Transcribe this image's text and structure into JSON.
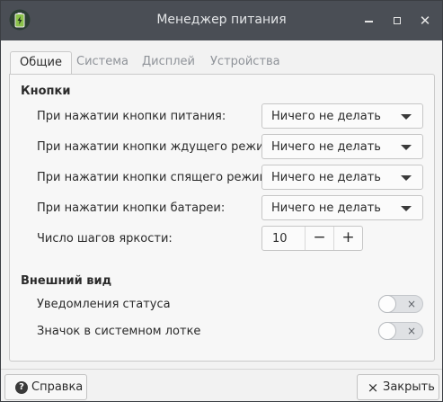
{
  "window": {
    "title": "Менеджер питания",
    "icon": "battery-icon"
  },
  "tabs": [
    {
      "label": "Общие",
      "active": true
    },
    {
      "label": "Система",
      "active": false
    },
    {
      "label": "Дисплей",
      "active": false
    },
    {
      "label": "Устройства",
      "active": false
    }
  ],
  "buttons_section": {
    "title": "Кнопки",
    "rows": [
      {
        "label": "При нажатии кнопки питания:",
        "value": "Ничего не делать"
      },
      {
        "label": "При нажатии кнопки ждущего режима:",
        "value": "Ничего не делать"
      },
      {
        "label": "При нажатии кнопки спящего режима:",
        "value": "Ничего не делать"
      },
      {
        "label": "При нажатии кнопки батареи:",
        "value": "Ничего не делать"
      }
    ],
    "brightness": {
      "label": "Число шагов яркости:",
      "value": "10",
      "minus": "−",
      "plus": "+"
    }
  },
  "appearance_section": {
    "title": "Внешний вид",
    "toggles": [
      {
        "label": "Уведомления статуса",
        "on": false,
        "off_glyph": "×"
      },
      {
        "label": "Значок в системном лотке",
        "on": false,
        "off_glyph": "×"
      }
    ]
  },
  "footer": {
    "help_label": "Справка",
    "help_icon_glyph": "?",
    "close_label": "Закрыть",
    "close_icon_glyph": "×"
  },
  "colors": {
    "titlebar": "#4a4e55",
    "window_bg": "#f2f2f2",
    "battery_green": "#8bc34a"
  }
}
